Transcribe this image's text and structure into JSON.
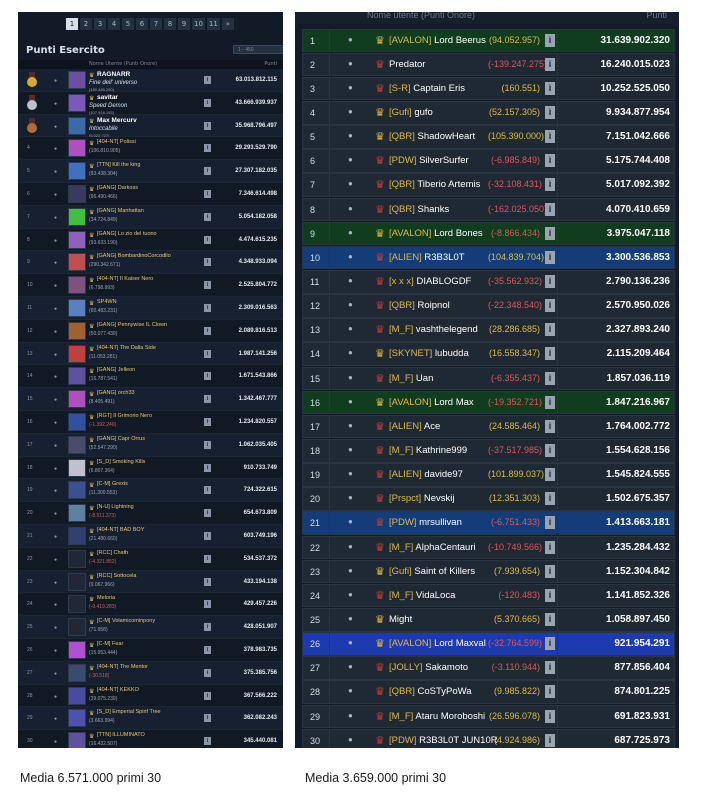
{
  "left": {
    "title": "Punti Esercito",
    "pages": [
      "1",
      "2",
      "3",
      "4",
      "5",
      "6",
      "7",
      "8",
      "9",
      "10",
      "11",
      "»"
    ],
    "active_page": "1",
    "select_value": "1 - 450",
    "header": {
      "name": "Nome Utente (Punti Onore)",
      "points": "Punti"
    },
    "rows": [
      {
        "rank": "1",
        "name": "RAGNARR",
        "sub": "Fine dell' universo",
        "sub2": "(180.485.290)",
        "pts": "63.013.812.115",
        "medal": "gold",
        "avatar": "#6a4fa0"
      },
      {
        "rank": "2",
        "name": "savitar",
        "sub": "Speed Demon",
        "sub2": "(107.916.193)",
        "pts": "43.666.939.937",
        "medal": "silver",
        "avatar": "#7a5ab8"
      },
      {
        "rank": "3",
        "name": "Max Mercurv",
        "sub": "Intoccabile",
        "sub2": "(5.022.727)",
        "pts": "35.968.796.497",
        "medal": "bronze",
        "avatar": "#3a6aa8"
      },
      {
        "rank": "4",
        "name": "[404-NT] Polissi",
        "sub": "(106.810.905)",
        "pts": "29.293.529.790",
        "avatar": "#b050c0"
      },
      {
        "rank": "5",
        "name": "[TTN] Kill the king",
        "sub": "(93.438.304)",
        "pts": "27.307.182.035",
        "avatar": "#4070c0"
      },
      {
        "rank": "6",
        "name": "[GANG] Darkoss",
        "sub": "(96.490.466)",
        "pts": "7.346.614.498",
        "avatar": "#3a3a60"
      },
      {
        "rank": "7",
        "name": "[GANG] Manhattan",
        "sub": "(34.724.849)",
        "pts": "5.054.182.058",
        "avatar": "#40c040"
      },
      {
        "rank": "8",
        "name": "[GANG] Lo zio del tuono",
        "sub": "(93.633.190)",
        "pts": "4.474.615.235",
        "avatar": "#9060c0"
      },
      {
        "rank": "9",
        "name": "[GANG] BombardinoCorcodilo",
        "sub": "(290.342.671)",
        "pts": "4.348.933.094",
        "avatar": "#c05050"
      },
      {
        "rank": "10",
        "name": "[404-NT] Il Kaiser Nero",
        "sub": "(6.798.993)",
        "pts": "2.525.804.772",
        "avatar": "#805080"
      },
      {
        "rank": "11",
        "name": "SP4WN",
        "sub": "(60.483.231)",
        "pts": "2.309.016.563",
        "avatar": "#5a80c0"
      },
      {
        "rank": "12",
        "name": "[GANG] Pennywise IL Clown",
        "sub": "(50.077.439)",
        "pts": "2.089.816.513",
        "avatar": "#a06030"
      },
      {
        "rank": "13",
        "name": "[404-NT] The Dalla Side",
        "sub": "(11.053.281)",
        "pts": "1.987.141.256",
        "avatar": "#c04040"
      },
      {
        "rank": "14",
        "name": "[GANG] Jelleon",
        "sub": "(16.787.541)",
        "pts": "1.671.543.866",
        "avatar": "#6050a0"
      },
      {
        "rank": "15",
        "name": "[GANG] orch33",
        "sub": "(8.405.491)",
        "pts": "1.342.467.777",
        "avatar": "#b050c0"
      },
      {
        "rank": "16",
        "name": "[RGT] Il Grimorio Nero",
        "sub": "(-1.392.240)",
        "pts": "1.234.820.557",
        "avatar": "#3050a0",
        "neg": true
      },
      {
        "rank": "17",
        "name": "[GANG] Capr Orrus",
        "sub": "(52.547.290)",
        "pts": "1.062.035.405",
        "avatar": "#4a4a6a"
      },
      {
        "rank": "18",
        "name": "[S_D] Smoking Kills",
        "sub": "(6.807.364)",
        "pts": "910.733.749",
        "avatar": "#c0c0d0"
      },
      {
        "rank": "19",
        "name": "[C-M] Grexis",
        "sub": "(11.300.553)",
        "pts": "724.322.615",
        "avatar": "#3a5090"
      },
      {
        "rank": "20",
        "name": "[N-U] Lightning",
        "sub": "(-8.511.373)",
        "pts": "654.673.809",
        "avatar": "#6080a0",
        "neg": true
      },
      {
        "rank": "21",
        "name": "[404-NT] BAD BOY",
        "sub": "(21.480.660)",
        "pts": "603.749.196",
        "avatar": "#304070"
      },
      {
        "rank": "22",
        "name": "[RCC] Chath",
        "sub": "(-4.321.852)",
        "pts": "534.537.372",
        "avatar": "#202838",
        "neg": true
      },
      {
        "rank": "23",
        "name": "[RCC] Sottocela",
        "sub": "(9.067.966)",
        "pts": "433.194.138",
        "avatar": "#202838"
      },
      {
        "rank": "24",
        "name": "Meloria",
        "sub": "(-9.419.283)",
        "pts": "429.457.226",
        "avatar": "#202838",
        "neg": true
      },
      {
        "rank": "25",
        "name": "[C-M] Volamicominpony",
        "sub": "(71.958)",
        "pts": "428.051.907",
        "avatar": "#202838"
      },
      {
        "rank": "26",
        "name": "[C-M] Fear",
        "sub": "(15.953.444)",
        "pts": "378.983.735",
        "avatar": "#b050d0"
      },
      {
        "rank": "27",
        "name": "[404-NT] The Mentor",
        "sub": "(-30.518)",
        "pts": "375.385.756",
        "avatar": "#3a4a70",
        "neg": true
      },
      {
        "rank": "28",
        "name": "[404-NT] KEKKO",
        "sub": "(39.075.239)",
        "pts": "367.566.222",
        "avatar": "#4a4aa0"
      },
      {
        "rank": "29",
        "name": "[S_D] Emperial Spirif Tree",
        "sub": "(3.663.994)",
        "pts": "362.082.243",
        "avatar": "#5050b0"
      },
      {
        "rank": "30",
        "name": "[TTN] ILLUMINATO",
        "sub": "(16.432.507)",
        "pts": "345.440.081",
        "avatar": "#6050a0"
      }
    ]
  },
  "right": {
    "header": {
      "name": "Nome utente (Punti Onore)",
      "points": "Punti"
    },
    "rows": [
      {
        "rank": "1",
        "tag": "[AVALON]",
        "name": "Lord Beerus",
        "diff": "(94.052.957)",
        "pts": "31.639.902.320",
        "hl": "g",
        "crest": "gold",
        "neg": false
      },
      {
        "rank": "2",
        "tag": "",
        "name": "Predator",
        "diff": "(-139.247.275)",
        "pts": "16.240.015.023",
        "hl": "",
        "crest": "red",
        "neg": true
      },
      {
        "rank": "3",
        "tag": "[S-R]",
        "name": "Captain Eris",
        "diff": "(160.551)",
        "pts": "10.252.525.050",
        "hl": "",
        "crest": "red",
        "neg": false
      },
      {
        "rank": "4",
        "tag": "[Gufi]",
        "name": "gufo",
        "diff": "(52.157.305)",
        "pts": "9.934.877.954",
        "hl": "",
        "crest": "gold",
        "neg": false
      },
      {
        "rank": "5",
        "tag": "[QBR]",
        "name": "ShadowHeart",
        "diff": "(105.390.000)",
        "pts": "7.151.042.666",
        "hl": "",
        "crest": "gold",
        "neg": false
      },
      {
        "rank": "6",
        "tag": "[PDW]",
        "name": "SilverSurfer",
        "diff": "(-6.985.849)",
        "pts": "5.175.744.408",
        "hl": "",
        "crest": "red",
        "neg": true
      },
      {
        "rank": "7",
        "tag": "[QBR]",
        "name": "Tiberio Artemis",
        "diff": "(-32.108.431)",
        "pts": "5.017.092.392",
        "hl": "",
        "crest": "red",
        "neg": true
      },
      {
        "rank": "8",
        "tag": "[QBR]",
        "name": "Shanks",
        "diff": "(-162.025.050)",
        "pts": "4.070.410.659",
        "hl": "",
        "crest": "red",
        "neg": true
      },
      {
        "rank": "9",
        "tag": "[AVALON]",
        "name": "Lord Bones",
        "diff": "(-8.866.434)",
        "pts": "3.975.047.118",
        "hl": "g",
        "crest": "gold",
        "neg": true
      },
      {
        "rank": "10",
        "tag": "[ALIEN]",
        "name": "R3B3L0T",
        "diff": "(104.839.704)",
        "pts": "3.300.536.853",
        "hl": "b",
        "crest": "red",
        "neg": false
      },
      {
        "rank": "11",
        "tag": "[x x x]",
        "name": "DIABLOGDF",
        "diff": "(-35.562.932)",
        "pts": "2.790.136.236",
        "hl": "",
        "crest": "red",
        "neg": true
      },
      {
        "rank": "12",
        "tag": "[QBR]",
        "name": "Roipnol",
        "diff": "(-22.348.540)",
        "pts": "2.570.950.026",
        "hl": "",
        "crest": "red",
        "neg": true
      },
      {
        "rank": "13",
        "tag": "[M_F]",
        "name": "vashthelegend",
        "diff": "(28.286.685)",
        "pts": "2.327.893.240",
        "hl": "",
        "crest": "red",
        "neg": false
      },
      {
        "rank": "14",
        "tag": "[SKYNET]",
        "name": "lubudda",
        "diff": "(16.558.347)",
        "pts": "2.115.209.464",
        "hl": "",
        "crest": "gold",
        "neg": false
      },
      {
        "rank": "15",
        "tag": "[M_F]",
        "name": "Uan",
        "diff": "(-6.355.437)",
        "pts": "1.857.036.119",
        "hl": "",
        "crest": "red",
        "neg": true
      },
      {
        "rank": "16",
        "tag": "[AVALON]",
        "name": "Lord Max",
        "diff": "(-19.352.721)",
        "pts": "1.847.216.967",
        "hl": "g",
        "crest": "gold",
        "neg": true
      },
      {
        "rank": "17",
        "tag": "[ALIEN]",
        "name": "Ace",
        "diff": "(24.585.464)",
        "pts": "1.764.002.772",
        "hl": "",
        "crest": "red",
        "neg": false
      },
      {
        "rank": "18",
        "tag": "[M_F]",
        "name": "Kathrine999",
        "diff": "(-37.517.985)",
        "pts": "1.554.628.156",
        "hl": "",
        "crest": "red",
        "neg": true
      },
      {
        "rank": "19",
        "tag": "[ALIEN]",
        "name": "davide97",
        "diff": "(101.899.037)",
        "pts": "1.545.824.555",
        "hl": "",
        "crest": "red",
        "neg": false
      },
      {
        "rank": "20",
        "tag": "[Prspct]",
        "name": "Nevskij",
        "diff": "(12.351.303)",
        "pts": "1.502.675.357",
        "hl": "",
        "crest": "red",
        "neg": false
      },
      {
        "rank": "21",
        "tag": "[PDW]",
        "name": "mrsullivan",
        "diff": "(-6.751.433)",
        "pts": "1.413.663.181",
        "hl": "b",
        "crest": "red",
        "neg": true
      },
      {
        "rank": "22",
        "tag": "[M_F]",
        "name": "AlphaCentauri",
        "diff": "(-10.749.566)",
        "pts": "1.235.284.432",
        "hl": "",
        "crest": "red",
        "neg": true
      },
      {
        "rank": "23",
        "tag": "[Gufi]",
        "name": "Saint of Killers",
        "diff": "(7.939.654)",
        "pts": "1.152.304.842",
        "hl": "",
        "crest": "gold",
        "neg": false
      },
      {
        "rank": "24",
        "tag": "[M_F]",
        "name": "VidaLoca",
        "diff": "(-120.483)",
        "pts": "1.141.852.326",
        "hl": "",
        "crest": "red",
        "neg": true
      },
      {
        "rank": "25",
        "tag": "",
        "name": "Might",
        "diff": "(5.370.665)",
        "pts": "1.058.897.450",
        "hl": "",
        "crest": "gold",
        "neg": false
      },
      {
        "rank": "26",
        "tag": "[AVALON]",
        "name": "Lord Maxval",
        "diff": "(-32.764.599)",
        "pts": "921.954.291",
        "hl": "bb",
        "crest": "gold",
        "neg": true
      },
      {
        "rank": "27",
        "tag": "[JOLLY]",
        "name": "Sakamoto",
        "diff": "(-3.110.944)",
        "pts": "877.856.404",
        "hl": "",
        "crest": "red",
        "neg": true
      },
      {
        "rank": "28",
        "tag": "[QBR]",
        "name": "CoSTyPoWa",
        "diff": "(9.985.822)",
        "pts": "874.801.225",
        "hl": "",
        "crest": "red",
        "neg": false
      },
      {
        "rank": "29",
        "tag": "[M_F]",
        "name": "Ataru Moroboshi",
        "diff": "(26.596.078)",
        "pts": "691.823.931",
        "hl": "",
        "crest": "red",
        "neg": false
      },
      {
        "rank": "30",
        "tag": "[PDW]",
        "name": "R3B3L0T JUN10R",
        "diff": "(4.924.986)",
        "pts": "687.725.973",
        "hl": "",
        "crest": "red",
        "neg": false
      }
    ]
  },
  "captions": {
    "left": "Media 6.571.000 primi 30",
    "right": "Media 3.659.000 primi 30"
  },
  "colors": {
    "left_bg": "#121a27",
    "right_bg": "#121c28",
    "highlight_green": "#0f3d1e",
    "highlight_blue": "#143c78",
    "highlight_bright_blue": "#1d3ab0",
    "tag_gold": "#e0b94a",
    "negative_red": "#e05656"
  },
  "icons": {
    "info": "info-icon",
    "rank_crest": "crest-icon",
    "medal": "medal-icon",
    "status_dot": "dot-icon",
    "dropdown": "chevron-down-icon"
  },
  "glyphs": {
    "info": "i",
    "dot": "●",
    "crest": "♛"
  }
}
